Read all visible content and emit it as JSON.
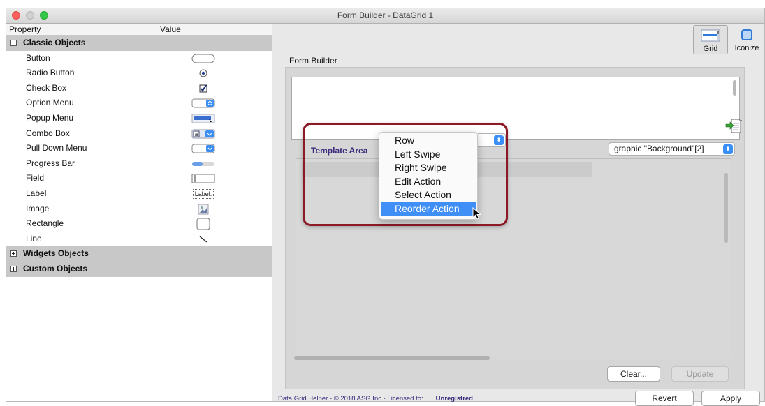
{
  "window": {
    "title": "Form Builder - DataGrid 1"
  },
  "property_panel": {
    "headers": {
      "property": "Property",
      "value": "Value"
    },
    "classic_group": "Classic Objects",
    "classic_items": [
      {
        "label": "Button",
        "icon": "button-shape-icon"
      },
      {
        "label": "Radio Button",
        "icon": "radio-button-icon"
      },
      {
        "label": "Check Box",
        "icon": "checkbox-icon"
      },
      {
        "label": "Option Menu",
        "icon": "option-menu-icon"
      },
      {
        "label": "Popup Menu",
        "icon": "popup-menu-icon"
      },
      {
        "label": "Combo Box",
        "icon": "combo-box-icon"
      },
      {
        "label": "Pull Down Menu",
        "icon": "pull-down-menu-icon"
      },
      {
        "label": "Progress Bar",
        "icon": "progress-bar-icon"
      },
      {
        "label": "Field",
        "icon": "field-icon"
      },
      {
        "label": "Label",
        "icon": "label-icon",
        "icon_text": "Label:"
      },
      {
        "label": "Image",
        "icon": "image-icon"
      },
      {
        "label": "Rectangle",
        "icon": "rectangle-icon"
      },
      {
        "label": "Line",
        "icon": "line-icon"
      }
    ],
    "widgets_group": "Widgets Objects",
    "custom_group": "Custom Objects"
  },
  "toolbar": {
    "grid_label": "Grid",
    "iconize_label": "Iconize"
  },
  "form_builder": {
    "label": "Form Builder",
    "template_area_label": "Template Area",
    "background_select": "graphic \"Background\"[2]",
    "clear_button": "Clear...",
    "update_button": "Update"
  },
  "popup_menu": {
    "items": [
      "Row",
      "Left Swipe",
      "Right Swipe",
      "Edit Action",
      "Select Action",
      "Reorder Action"
    ],
    "selected": "Reorder Action"
  },
  "footer": {
    "status_text": "Data Grid Helper - © 2018 ASG Inc - Licensed to:",
    "license": "Unregistred",
    "revert_button": "Revert",
    "apply_button": "Apply"
  },
  "colors": {
    "accent": "#3f8ff7",
    "highlight_border": "#8c1a26",
    "label_purple": "#3b2a7c"
  }
}
